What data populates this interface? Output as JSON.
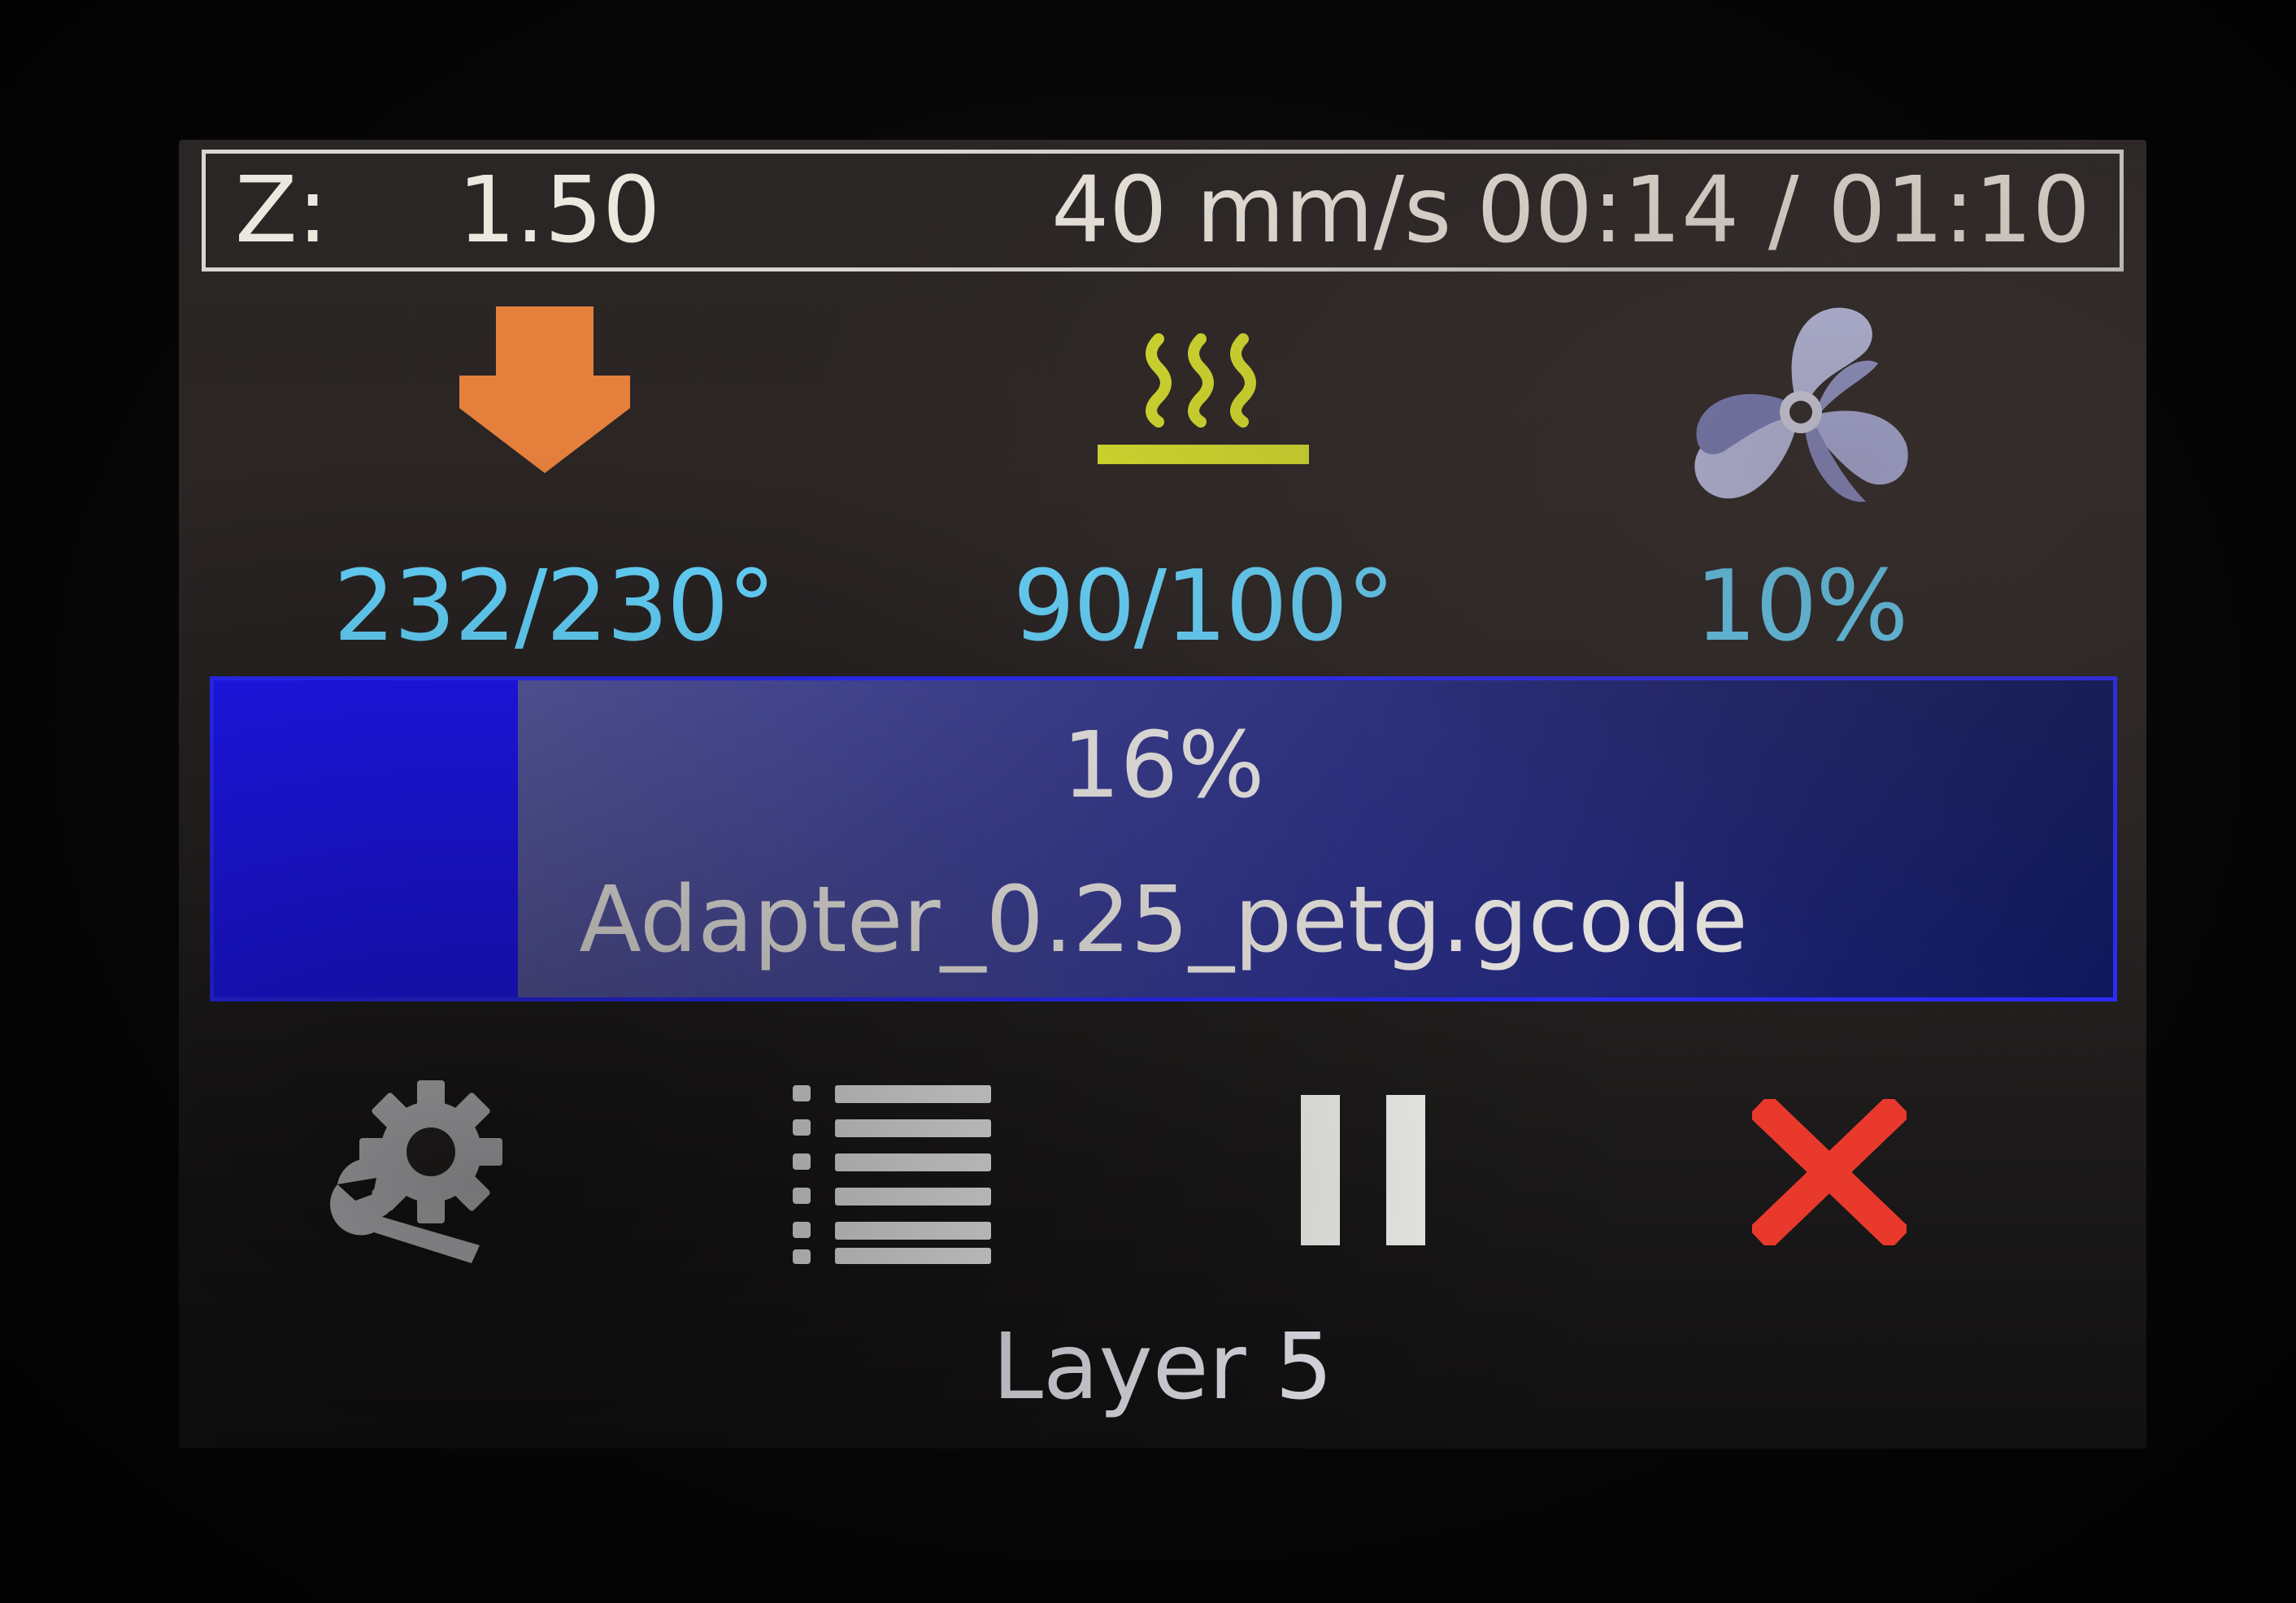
{
  "status": {
    "z_label": "Z:",
    "z_value": "1.50",
    "speed": "40 mm/s",
    "time": "00:14 / 01:10"
  },
  "nozzle": {
    "icon": "nozzle-down-arrow-icon",
    "value": "232/230°",
    "color": "#e4803c"
  },
  "bed": {
    "icon": "heated-bed-icon",
    "value": "90/100°",
    "color": "#d8e02c"
  },
  "fan": {
    "icon": "fan-icon",
    "value": "10%",
    "color": "#c8cdf6"
  },
  "progress": {
    "percent_label": "16%",
    "fraction": 0.16,
    "filename": "Adapter_0.25_petg.gcode",
    "fill_color": "#1f17f6",
    "border_color": "#2a2aff"
  },
  "buttons": {
    "settings_icon": "settings-wrench-icon",
    "list_icon": "list-icon",
    "pause_icon": "pause-icon",
    "stop_icon": "stop-x-icon",
    "stop_color": "#e8392c"
  },
  "layer": "Layer 5"
}
